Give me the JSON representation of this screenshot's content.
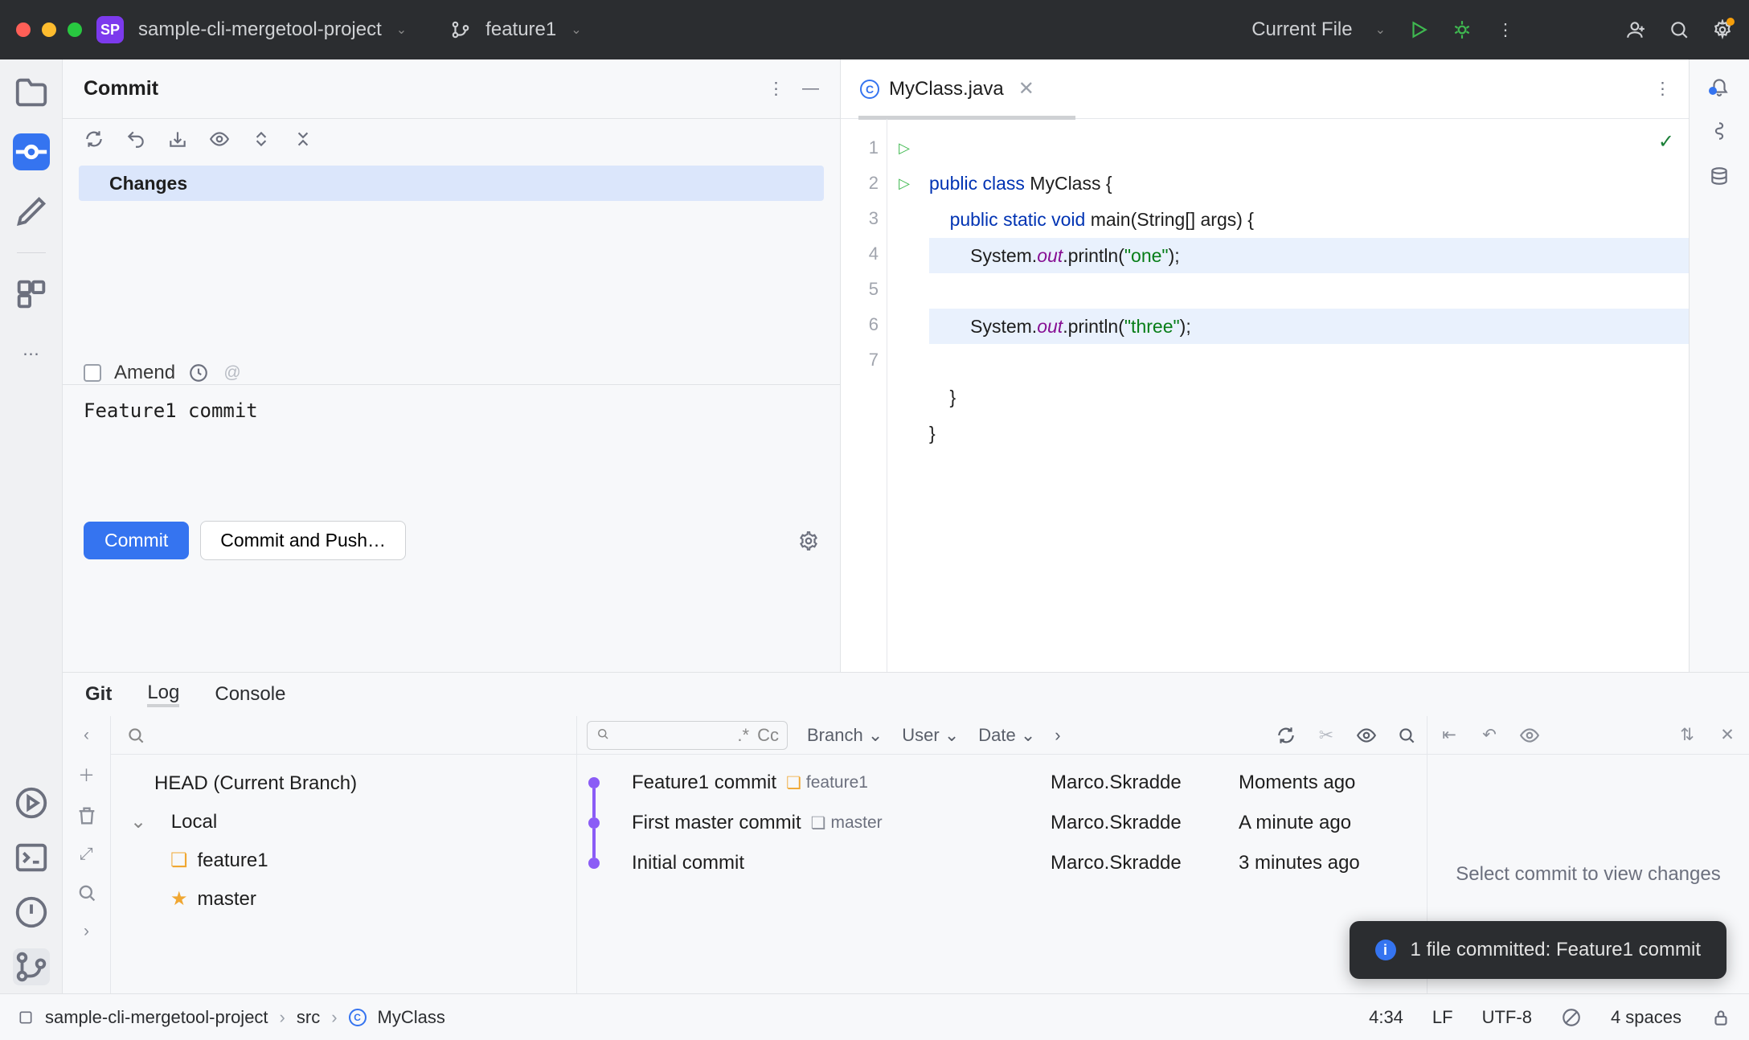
{
  "titlebar": {
    "project_icon": "SP",
    "project_name": "sample-cli-mergetool-project",
    "branch_name": "feature1",
    "run_config": "Current File"
  },
  "commit_pane": {
    "title": "Commit",
    "changes_label": "Changes",
    "amend_label": "Amend",
    "commit_message": "Feature1 commit",
    "commit_btn": "Commit",
    "commit_push_btn": "Commit and Push…"
  },
  "editor": {
    "tab_name": "MyClass.java",
    "lines": {
      "l1a": "public",
      "l1b": "class",
      "l1c": "MyClass {",
      "l2a": "public",
      "l2b": "static",
      "l2c": "void",
      "l2d": "main",
      "l2e": "(String[] args) {",
      "l3a": "System.",
      "l3b": "out",
      "l3c": ".println(",
      "l3d": "\"one\"",
      "l3e": ");",
      "l4a": "System.",
      "l4b": "out",
      "l4c": ".println(",
      "l4d": "\"three\"",
      "l4e": ");",
      "l5": "    }",
      "l6": "}"
    },
    "gutters": [
      "1",
      "2",
      "3",
      "4",
      "5",
      "6",
      "7"
    ]
  },
  "bottom_tabs": {
    "t0": "Git",
    "t1": "Log",
    "t2": "Console"
  },
  "branches": {
    "head_label": "HEAD (Current Branch)",
    "local_label": "Local",
    "items": {
      "b0": "feature1",
      "b1": "master"
    }
  },
  "log": {
    "filters": {
      "branch": "Branch",
      "user": "User",
      "date": "Date"
    },
    "regex_label": ".*",
    "case_label": "Cc",
    "rows": [
      {
        "msg": "Feature1 commit",
        "tag": "feature1",
        "author": "Marco.Skradde",
        "time": "Moments ago",
        "tag_color": "#f0a732"
      },
      {
        "msg": "First master commit",
        "tag": "master",
        "author": "Marco.Skradde",
        "time": "A minute ago",
        "tag_color": "#8b8f99"
      },
      {
        "msg": "Initial commit",
        "tag": "",
        "author": "Marco.Skradde",
        "time": "3 minutes ago"
      }
    ]
  },
  "detail_placeholder": "Select commit to view changes",
  "toast": {
    "text": "1 file committed: Feature1 commit"
  },
  "breadcrumb": {
    "root": "sample-cli-mergetool-project",
    "p1": "src",
    "p2": "MyClass"
  },
  "statusbar": {
    "pos": "4:34",
    "sep": "LF",
    "enc": "UTF-8",
    "indent": "4 spaces"
  }
}
